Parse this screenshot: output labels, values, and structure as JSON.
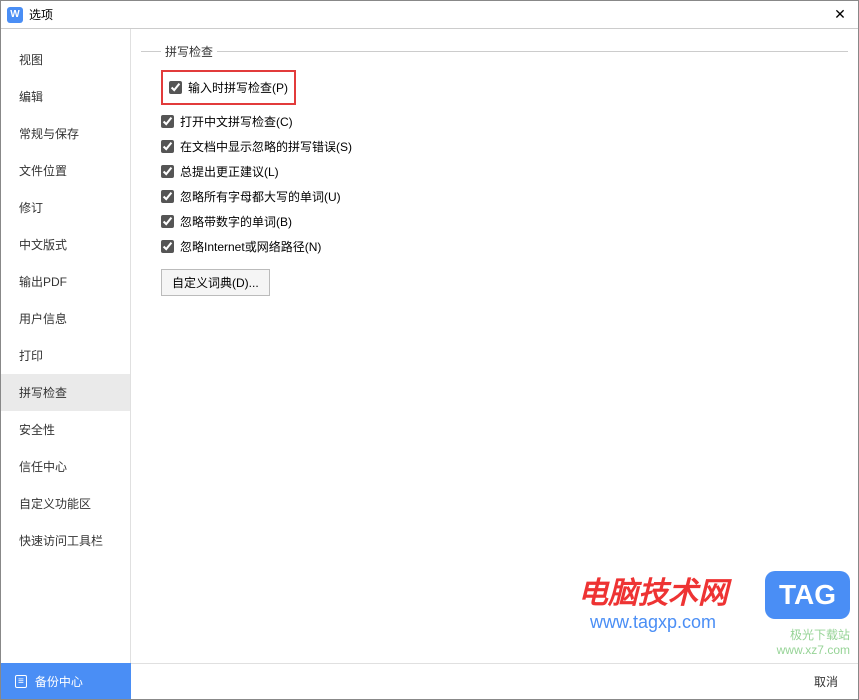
{
  "window": {
    "title": "选项",
    "close_label": "✕"
  },
  "sidebar": {
    "items": [
      {
        "label": "视图"
      },
      {
        "label": "编辑"
      },
      {
        "label": "常规与保存"
      },
      {
        "label": "文件位置"
      },
      {
        "label": "修订"
      },
      {
        "label": "中文版式"
      },
      {
        "label": "输出PDF"
      },
      {
        "label": "用户信息"
      },
      {
        "label": "打印"
      },
      {
        "label": "拼写检查"
      },
      {
        "label": "安全性"
      },
      {
        "label": "信任中心"
      },
      {
        "label": "自定义功能区"
      },
      {
        "label": "快速访问工具栏"
      }
    ],
    "selected_index": 9,
    "backup_label": "备份中心"
  },
  "content": {
    "legend": "拼写检查",
    "options": [
      {
        "label": "输入时拼写检查(P)",
        "checked": true,
        "highlighted": true
      },
      {
        "label": "打开中文拼写检查(C)",
        "checked": true
      },
      {
        "label": "在文档中显示忽略的拼写错误(S)",
        "checked": true
      },
      {
        "label": "总提出更正建议(L)",
        "checked": true
      },
      {
        "label": "忽略所有字母都大写的单词(U)",
        "checked": true
      },
      {
        "label": "忽略带数字的单词(B)",
        "checked": true
      },
      {
        "label": "忽略Internet或网络路径(N)",
        "checked": true
      }
    ],
    "custom_dict_label": "自定义词典(D)..."
  },
  "footer": {
    "cancel_label": "取消"
  },
  "watermarks": {
    "site1_line1": "电脑技术网",
    "site1_line2": "www.tagxp.com",
    "tag_label": "TAG",
    "site2_line1": "极光下载站",
    "site2_line2": "www.xz7.com"
  }
}
